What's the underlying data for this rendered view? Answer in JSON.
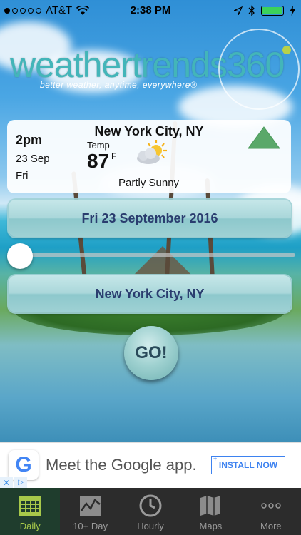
{
  "status_bar": {
    "carrier": "AT&T",
    "time": "2:38 PM",
    "signal_bars_filled": 1,
    "signal_bars_total": 5,
    "battery_color": "#3bd25a"
  },
  "brand": {
    "logo_word": "weathertrends",
    "logo_number": "360",
    "tagline": "better weather, anytime, everywhere®",
    "accent_color": "#43b5b9"
  },
  "forecast_card": {
    "time": "2pm",
    "date": "23 Sep",
    "day": "Fri",
    "city": "New York City, NY",
    "temp_label": "Temp",
    "temp_value": "87",
    "temp_unit": "F",
    "condition": "Partly Sunny",
    "condition_icon": "partly-sunny-icon",
    "trend_icon": "up-triangle-icon",
    "trend_color": "#5aa86a"
  },
  "date_button": {
    "label": "Fri 23 September 2016"
  },
  "date_slider": {
    "value_fraction": 0.0
  },
  "location_button": {
    "label": "New York City, NY"
  },
  "go_button": {
    "label": "GO!"
  },
  "ad_banner": {
    "logo_letter": "G",
    "text": "Meet the Google app.",
    "cta": "INSTALL NOW",
    "close_glyph": "✕",
    "adchoices_glyph": "▷"
  },
  "tab_bar": {
    "active_color": "#a7c94a",
    "items": [
      {
        "label": "Daily",
        "icon": "calendar-icon",
        "active": true
      },
      {
        "label": "10+ Day",
        "icon": "chart-icon",
        "active": false
      },
      {
        "label": "Hourly",
        "icon": "clock-icon",
        "active": false
      },
      {
        "label": "Maps",
        "icon": "map-icon",
        "active": false
      },
      {
        "label": "More",
        "icon": "more-icon",
        "active": false
      }
    ]
  }
}
